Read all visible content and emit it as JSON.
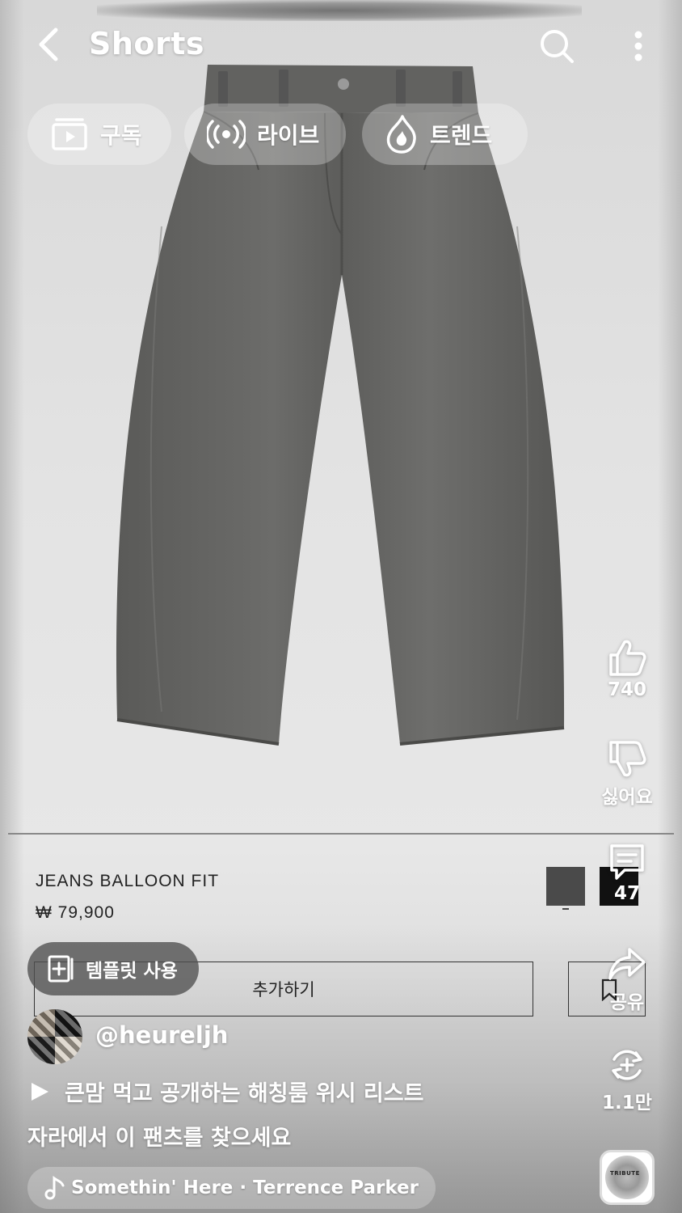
{
  "header": {
    "title": "Shorts"
  },
  "chips": [
    {
      "label": "구독",
      "icon": "subscriptions-icon"
    },
    {
      "label": "라이브",
      "icon": "live-broadcast-icon"
    },
    {
      "label": "트렌드",
      "icon": "trending-flame-icon"
    }
  ],
  "product": {
    "name": "JEANS BALLOON FIT",
    "price": "₩ 79,900",
    "swatch_colors": [
      "#4a4a4a",
      "#111111"
    ],
    "add_label": "추가하기"
  },
  "template": {
    "label": "템플릿 사용"
  },
  "actions": {
    "like_count": "740",
    "dislike_label": "싫어요",
    "comment_count": "47",
    "share_label": "공유",
    "remix_count": "1.1만"
  },
  "channel": {
    "handle": "@heureljh"
  },
  "caption": {
    "line1": "큰맘 먹고 공개하는 해칭룸 위시 리스트",
    "line2": "자라에서 이 팬츠를 찾으세요"
  },
  "music": {
    "track": "Somethin' Here · Terrence Parker",
    "disc_text": "TRIBUTE"
  }
}
